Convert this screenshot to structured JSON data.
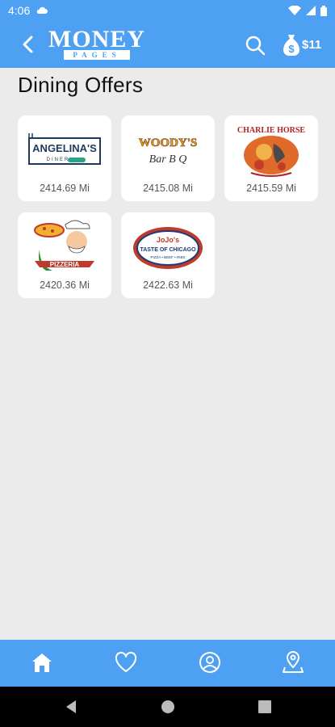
{
  "status": {
    "time": "4:06"
  },
  "header": {
    "logo_main": "MONEY",
    "logo_sub": "PAGES",
    "cash_label": "$11",
    "back_icon": "chevron-left-icon",
    "search_icon": "search-icon",
    "cash_icon": "money-bag-icon"
  },
  "page_title": "Dining Offers",
  "offers": [
    {
      "name": "ANGELINA'S",
      "sub": "DINER",
      "distance": "2414.69 Mi"
    },
    {
      "name": "WOODY'S",
      "sub": "Bar B Q",
      "distance": "2415.08 Mi"
    },
    {
      "name": "CHARLIE HORSE",
      "sub": "",
      "distance": "2415.59 Mi"
    },
    {
      "name": "PIZZERIA",
      "sub": "",
      "distance": "2420.36 Mi"
    },
    {
      "name": "JoJo's",
      "sub": "TASTE OF CHICAGO",
      "sub2": "PIZZA • BEEF • RIBS",
      "distance": "2422.63 Mi"
    }
  ],
  "nav": {
    "items": [
      "home-icon",
      "heart-icon",
      "profile-icon",
      "location-icon"
    ]
  },
  "colors": {
    "accent": "#4da0f2",
    "background": "#ebebeb"
  }
}
